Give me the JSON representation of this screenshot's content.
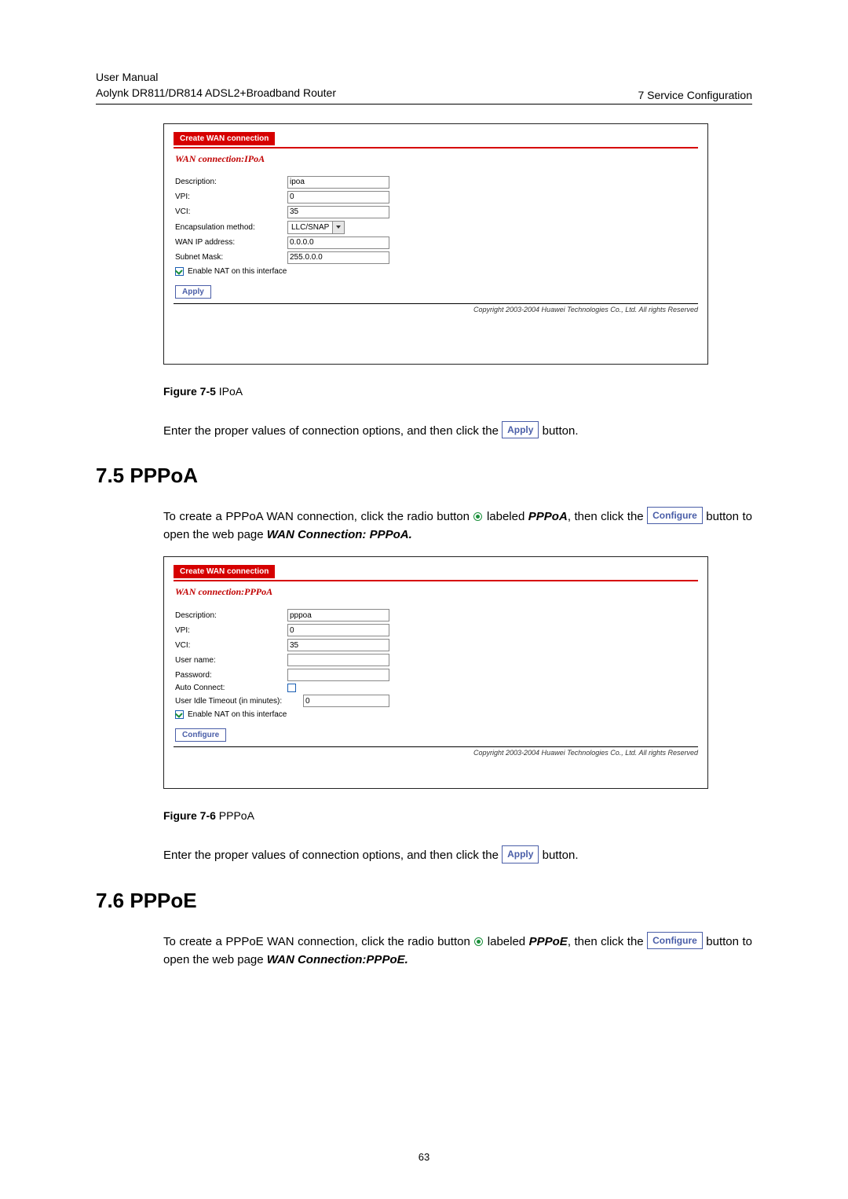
{
  "header": {
    "left_line1": "User Manual",
    "left_line2": "Aolynk DR811/DR814 ADSL2+Broadband Router",
    "right": "7  Service Configuration"
  },
  "fig1": {
    "tab": "Create WAN connection",
    "title": "WAN connection:IPoA",
    "rows": {
      "desc_label": "Description:",
      "desc_val": "ipoa",
      "vpi_label": "VPI:",
      "vpi_val": "0",
      "vci_label": "VCI:",
      "vci_val": "35",
      "encap_label": "Encapsulation method:",
      "encap_val": "LLC/SNAP",
      "wanip_label": "WAN IP address:",
      "wanip_val": "0.0.0.0",
      "mask_label": "Subnet Mask:",
      "mask_val": "255.0.0.0"
    },
    "nat_label": "Enable NAT on this interface",
    "apply": "Apply",
    "copyright": "Copyright 2003-2004 Huawei Technologies Co., Ltd. All rights Reserved",
    "caption_bold": "Figure 7-5 ",
    "caption_rest": "IPoA"
  },
  "text1_a": "Enter the proper values of connection options, and then click the ",
  "text1_btn": "Apply",
  "text1_b": " button.",
  "sec75": "7.5  PPPoA",
  "p75_a": "To create a PPPoA WAN connection, click the radio button ",
  "p75_b": " labeled ",
  "p75_bold1": "PPPoA",
  "p75_c": ", then click the ",
  "p75_btn": "Configure",
  "p75_d": " button to open the web page ",
  "p75_bold2": "WAN Connection: PPPoA.",
  "fig2": {
    "tab": "Create WAN connection",
    "title": "WAN connection:PPPoA",
    "rows": {
      "desc_label": "Description:",
      "desc_val": "pppoa",
      "vpi_label": "VPI:",
      "vpi_val": "0",
      "vci_label": "VCI:",
      "vci_val": "35",
      "user_label": "User name:",
      "pass_label": "Password:",
      "auto_label": "Auto Connect:",
      "idle_label": "User Idle Timeout (in minutes):",
      "idle_val": "0"
    },
    "nat_label": "Enable NAT on this interface",
    "configure": "Configure",
    "copyright": "Copyright 2003-2004 Huawei Technologies Co., Ltd. All rights Reserved",
    "caption_bold": "Figure 7-6 ",
    "caption_rest": "PPPoA"
  },
  "text2_a": "Enter the proper values of connection options, and then click the ",
  "text2_btn": "Apply",
  "text2_b": " button.",
  "sec76": "7.6  PPPoE",
  "p76_a": "To create a PPPoE WAN connection, click the radio button ",
  "p76_b": " labeled ",
  "p76_bold1": "PPPoE",
  "p76_c": ", then click the ",
  "p76_btn": "Configure",
  "p76_d": " button to open the web page ",
  "p76_bold2": "WAN Connection:PPPoE.",
  "page_number": "63"
}
